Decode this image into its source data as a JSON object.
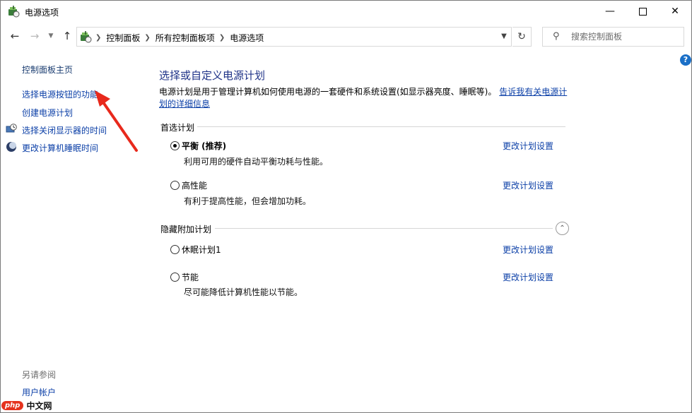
{
  "window": {
    "title": "电源选项"
  },
  "address": {
    "breadcrumbs": [
      "控制面板",
      "所有控制面板项",
      "电源选项"
    ]
  },
  "search": {
    "placeholder": "搜索控制面板"
  },
  "sidebar": {
    "home": "控制面板主页",
    "links": [
      {
        "label": "选择电源按钮的功能",
        "icon": ""
      },
      {
        "label": "创建电源计划",
        "icon": ""
      },
      {
        "label": "选择关闭显示器的时间",
        "icon": "monitor-clock-icon"
      },
      {
        "label": "更改计算机睡眠时间",
        "icon": "moon-icon"
      }
    ],
    "see_also": "另请参阅",
    "user_accounts": "用户帐户"
  },
  "main": {
    "heading": "选择或自定义电源计划",
    "description": "电源计划是用于管理计算机如何使用电源的一套硬件和系统设置(如显示器亮度、睡眠等)。",
    "learn_more": "告诉我有关电源计划的详细信息",
    "preferred_group": "首选计划",
    "hidden_group": "隐藏附加计划",
    "change_label": "更改计划设置",
    "plans": [
      {
        "name": "平衡 (推荐)",
        "description": "利用可用的硬件自动平衡功耗与性能。",
        "selected": true
      },
      {
        "name": "高性能",
        "description": "有利于提高性能，但会增加功耗。",
        "selected": false
      },
      {
        "name": "休眠计划1",
        "description": "",
        "selected": false
      },
      {
        "name": "节能",
        "description": "尽可能降低计算机性能以节能。",
        "selected": false
      }
    ]
  },
  "watermark": {
    "logo": "php",
    "text": "中文网"
  },
  "colors": {
    "link": "#0b3fa7",
    "heading": "#1e3287",
    "arrow": "#e8291c"
  }
}
